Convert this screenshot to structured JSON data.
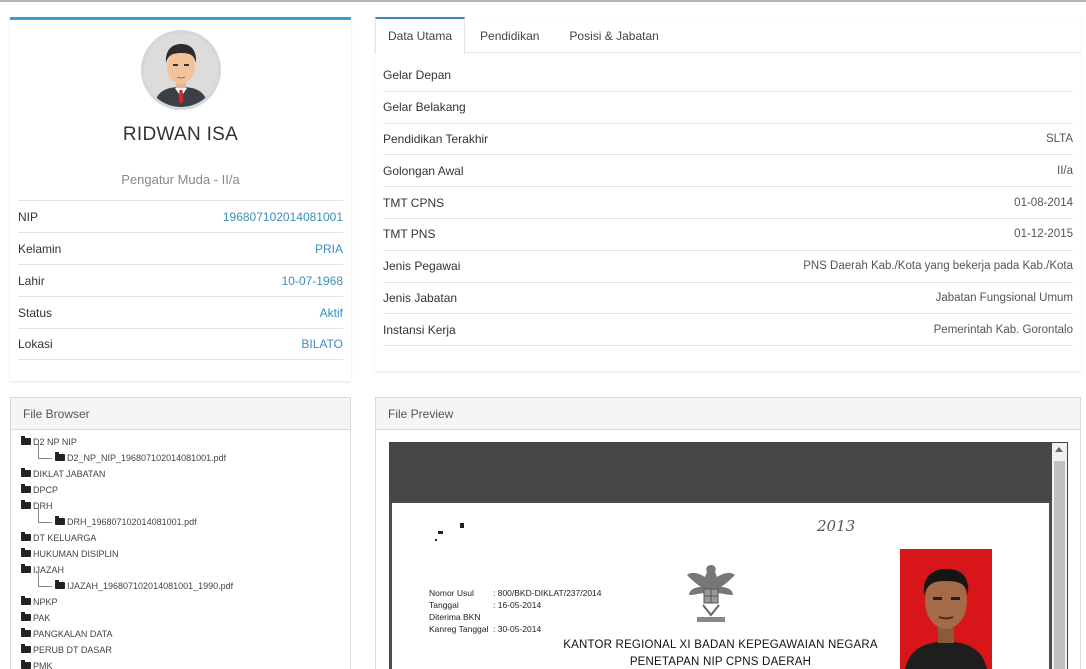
{
  "profile": {
    "name": "RIDWAN ISA",
    "rank": "Pengatur Muda - II/a",
    "fields": [
      {
        "label": "NIP",
        "value": "196807102014081001"
      },
      {
        "label": "Kelamin",
        "value": "PRIA"
      },
      {
        "label": "Lahir",
        "value": "10-07-1968"
      },
      {
        "label": "Status",
        "value": "Aktif"
      },
      {
        "label": "Lokasi",
        "value": "BILATO"
      }
    ]
  },
  "tabs": [
    {
      "label": "Data Utama",
      "active": true
    },
    {
      "label": "Pendidikan",
      "active": false
    },
    {
      "label": "Posisi & Jabatan",
      "active": false
    }
  ],
  "details": [
    {
      "label": "Gelar Depan",
      "value": ""
    },
    {
      "label": "Gelar Belakang",
      "value": ""
    },
    {
      "label": "Pendidikan Terakhir",
      "value": "SLTA"
    },
    {
      "label": "Golongan Awal",
      "value": "II/a"
    },
    {
      "label": "TMT CPNS",
      "value": "01-08-2014"
    },
    {
      "label": "TMT PNS",
      "value": "01-12-2015"
    },
    {
      "label": "Jenis Pegawai",
      "value": "PNS Daerah Kab./Kota yang bekerja pada Kab./Kota"
    },
    {
      "label": "Jenis Jabatan",
      "value": "Jabatan Fungsional Umum"
    },
    {
      "label": "Instansi Kerja",
      "value": "Pemerintah Kab. Gorontalo"
    }
  ],
  "file_browser": {
    "title": "File Browser",
    "items": [
      {
        "label": "D2 NP NIP",
        "child": false
      },
      {
        "label": "D2_NP_NIP_196807102014081001.pdf",
        "child": true
      },
      {
        "label": "DIKLAT JABATAN",
        "child": false
      },
      {
        "label": "DPCP",
        "child": false
      },
      {
        "label": "DRH",
        "child": false
      },
      {
        "label": "DRH_196807102014081001.pdf",
        "child": true
      },
      {
        "label": "DT KELUARGA",
        "child": false
      },
      {
        "label": "HUKUMAN DISIPLIN",
        "child": false
      },
      {
        "label": "IJAZAH",
        "child": false
      },
      {
        "label": "IJAZAH_196807102014081001_1990.pdf",
        "child": true
      },
      {
        "label": "NPKP",
        "child": false
      },
      {
        "label": "PAK",
        "child": false
      },
      {
        "label": "PANGKALAN DATA",
        "child": false
      },
      {
        "label": "PERUB DT DASAR",
        "child": false
      },
      {
        "label": "PMK",
        "child": false
      }
    ]
  },
  "file_preview": {
    "title": "File Preview",
    "document": {
      "handwriting": "2013",
      "meta": [
        {
          "label": "Nomor Usul",
          "value": ": 800/BKD-DIKLAT/237/2014"
        },
        {
          "label": "Tanggal",
          "value": ": 16-05-2014"
        },
        {
          "label": "Diterima BKN\nKanreg Tanggal",
          "value": ": 30-05-2014"
        }
      ],
      "heading_1": "KANTOR REGIONAL XI BADAN KEPEGAWAIAN NEGARA",
      "heading_2": "PENETAPAN NIP CPNS DAERAH"
    }
  },
  "colors": {
    "accent": "#3c8dbc",
    "card_top": "#3c9ccf",
    "photo_bg": "#d8161a",
    "viewer_bg": "#4d4d4d"
  }
}
